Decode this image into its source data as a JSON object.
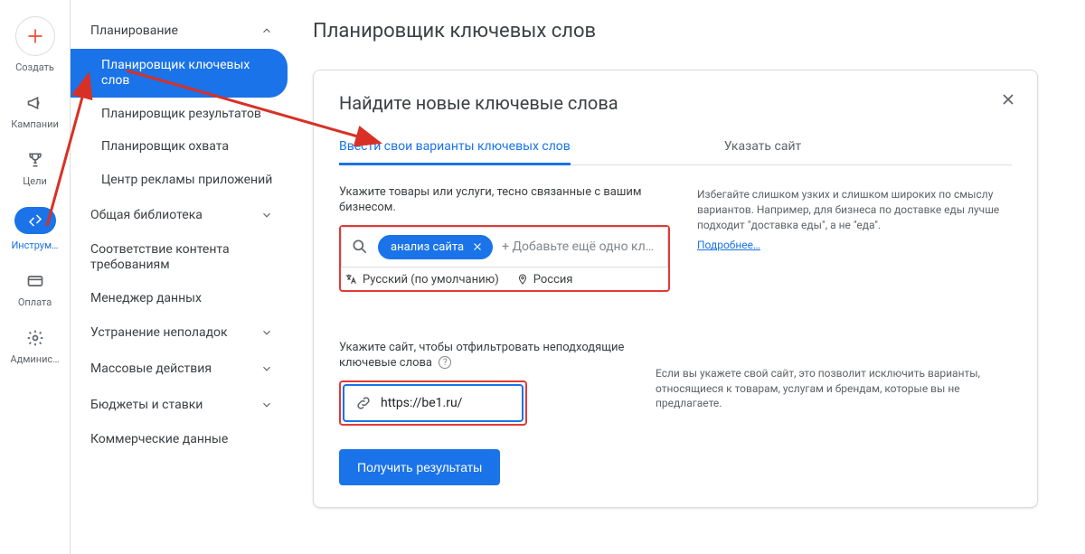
{
  "rail": {
    "create": "Создать",
    "campaigns": "Кампании",
    "goals": "Цели",
    "tools": "Инструм…",
    "billing": "Оплата",
    "admin": "Админис…"
  },
  "sidenav": {
    "planning": "Планирование",
    "planning_items": [
      "Планировщик ключевых слов",
      "Планировщик результатов",
      "Планировщик охвата",
      "Центр рекламы приложений"
    ],
    "shared": "Общая библиотека",
    "compliance": "Соответствие контента требованиям",
    "dm": "Менеджер данных",
    "trouble": "Устранение неполадок",
    "bulk": "Массовые действия",
    "budgets": "Бюджеты и ставки",
    "commercial": "Коммерческие данные"
  },
  "main": {
    "page_title": "Планировщик ключевых слов",
    "card_title": "Найдите новые ключевые слова",
    "tab1": "Ввести свои варианты ключевых слов",
    "tab2": "Указать сайт",
    "field1": "Укажите товары или услуги, тесно связанные с вашим бизнесом.",
    "chip": "анализ сайта",
    "ghost": "+ Добавьте ещё одно ключ...",
    "lang": "Русский (по умолчанию)",
    "loc": "Россия",
    "tip1": "Избегайте слишком узких и слишком широких по смыслу вариантов. Например, для бизнеса по доставке еды лучше подходит \"доставка еды\", а не \"еда\".",
    "learn_more": "Подробнее…",
    "field2": "Укажите сайт, чтобы отфильтровать неподходящие ключевые слова",
    "url": "https://be1.ru/",
    "tip2": "Если вы укажете свой сайт, это позволит исключить варианты, относящиеся к товарам, услугам и брендам, которые вы не предлагаете.",
    "submit": "Получить результаты"
  }
}
